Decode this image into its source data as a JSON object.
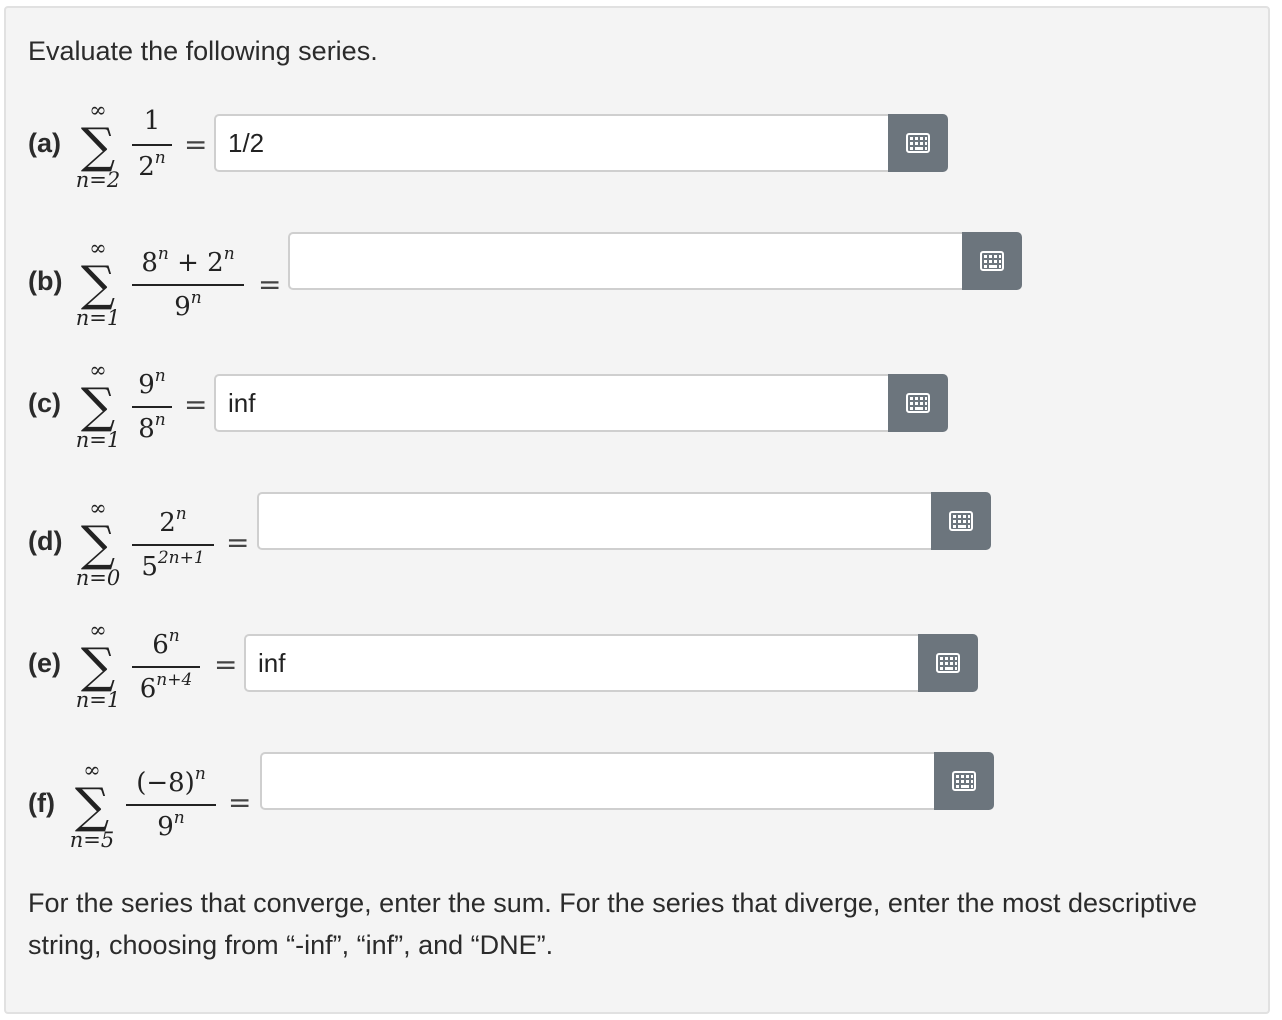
{
  "intro": "Evaluate the following series.",
  "problems": [
    {
      "label": "(a)",
      "upper": "∞",
      "lower": "n=2",
      "numerator": "1",
      "denominator_base": "2",
      "denominator_exp": "n",
      "answer": "1/2"
    },
    {
      "label": "(b)",
      "upper": "∞",
      "lower": "n=1",
      "numerator_a": "8",
      "numerator_plus": " + ",
      "numerator_b": "2",
      "numerator_exp": "n",
      "denominator_base": "9",
      "denominator_exp": "n",
      "answer": ""
    },
    {
      "label": "(c)",
      "upper": "∞",
      "lower": "n=1",
      "numerator_base": "9",
      "numerator_exp": "n",
      "denominator_base": "8",
      "denominator_exp": "n",
      "answer": "inf"
    },
    {
      "label": "(d)",
      "upper": "∞",
      "lower": "n=0",
      "numerator_base": "2",
      "numerator_exp": "n",
      "denominator_base": "5",
      "denominator_exp": "2n+1",
      "answer": ""
    },
    {
      "label": "(e)",
      "upper": "∞",
      "lower": "n=1",
      "numerator_base": "6",
      "numerator_exp": "n",
      "denominator_base": "6",
      "denominator_exp": "n+4",
      "answer": "inf"
    },
    {
      "label": "(f)",
      "upper": "∞",
      "lower": "n=5",
      "numerator_base": "(−8)",
      "numerator_exp": "n",
      "denominator_base": "9",
      "denominator_exp": "n",
      "answer": ""
    }
  ],
  "equals": "=",
  "keyboard_icon": "keyboard-icon",
  "footer": "For the series that converge, enter the sum. For the series that diverge, enter the most descriptive string, choosing from “-inf”, “inf”, and “DNE”.",
  "colors": {
    "button": "#6c757d",
    "panel": "#f4f4f4",
    "field_border": "#cfcfcf"
  }
}
